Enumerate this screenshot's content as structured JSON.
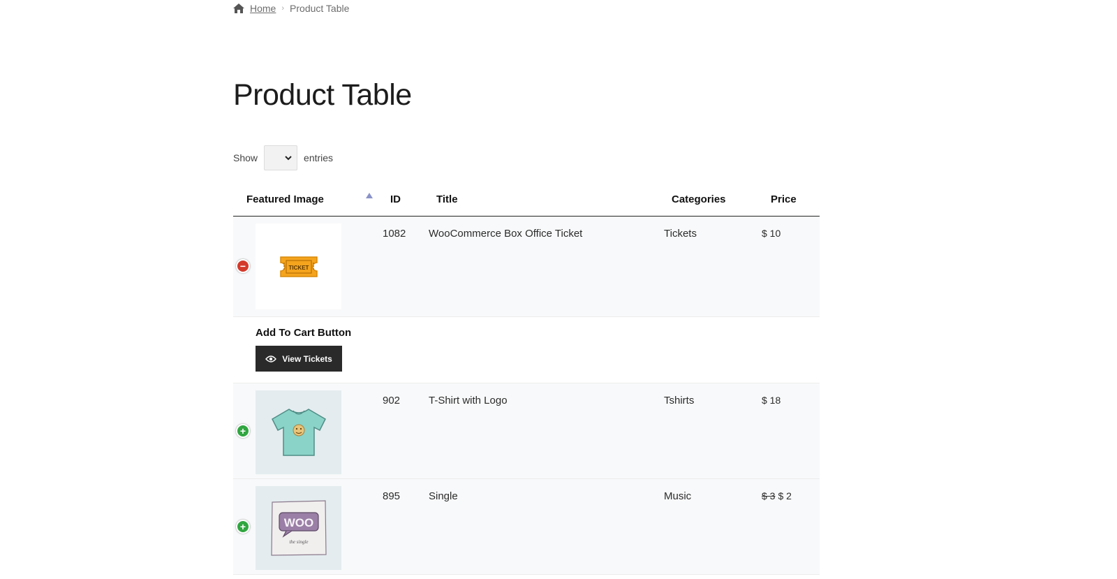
{
  "breadcrumb": {
    "home": "Home",
    "current": "Product Table"
  },
  "page_title": "Product Table",
  "entries": {
    "show_label": "Show",
    "entries_label": "entries",
    "selected": ""
  },
  "table": {
    "headers": {
      "featured_image": "Featured Image",
      "id": "ID",
      "title": "Title",
      "categories": "Categories",
      "price": "Price"
    },
    "rows": [
      {
        "id": "1082",
        "title": "WooCommerce Box Office Ticket",
        "category": "Tickets",
        "price": "$ 10",
        "old_price": "",
        "image": "ticket-image",
        "image_text": "TICKET",
        "expanded": true,
        "child": {
          "label": "Add To Cart Button",
          "button": "View Tickets"
        }
      },
      {
        "id": "902",
        "title": "T-Shirt with Logo",
        "category": "Tshirts",
        "price": "$ 18",
        "old_price": "",
        "image": "tshirt-image",
        "expanded": false
      },
      {
        "id": "895",
        "title": "Single",
        "category": "Music",
        "price": "$ 2",
        "old_price": "$ 3",
        "image": "woo-single-image",
        "image_text": "WOO",
        "image_subtext": "the single",
        "expanded": false
      }
    ]
  },
  "colors": {
    "toggle_minus": "#d33a2c",
    "toggle_plus": "#31a641",
    "button_bg": "#2a2a2a",
    "row_bg": "#f8f9fa",
    "sort_arrow": "#8a93c8"
  }
}
